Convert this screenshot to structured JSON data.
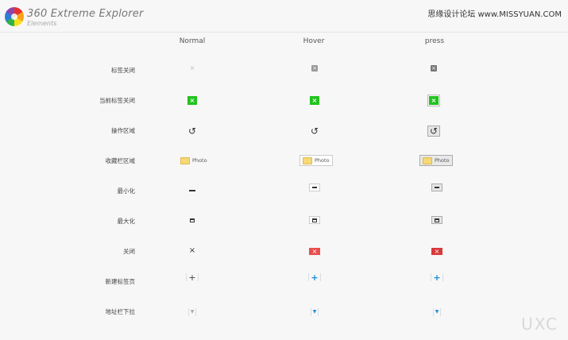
{
  "header": {
    "title": "360  Extreme Explorer",
    "subtitle": "Elements",
    "site": "思缘设计论坛 www.MISSYUAN.COM",
    "logo_icon": "360-logo-icon"
  },
  "columns": [
    "Normal",
    "Hover",
    "press"
  ],
  "rows": [
    {
      "label": "标签关闭"
    },
    {
      "label": "当前标签关闭"
    },
    {
      "label": "操作区域"
    },
    {
      "label": "收藏栏区域",
      "fav_text": "Photo"
    },
    {
      "label": "最小化"
    },
    {
      "label": "最大化"
    },
    {
      "label": "关闭"
    },
    {
      "label": "新建标签页"
    },
    {
      "label": "地址栏下拉"
    }
  ],
  "glyphs": {
    "x": "×",
    "undo": "↺",
    "plus": "+",
    "caret": "▼"
  },
  "colors": {
    "green": "#22c21e",
    "red": "#e94f4f",
    "blue": "#1a8fd8"
  },
  "watermark": "UXC"
}
